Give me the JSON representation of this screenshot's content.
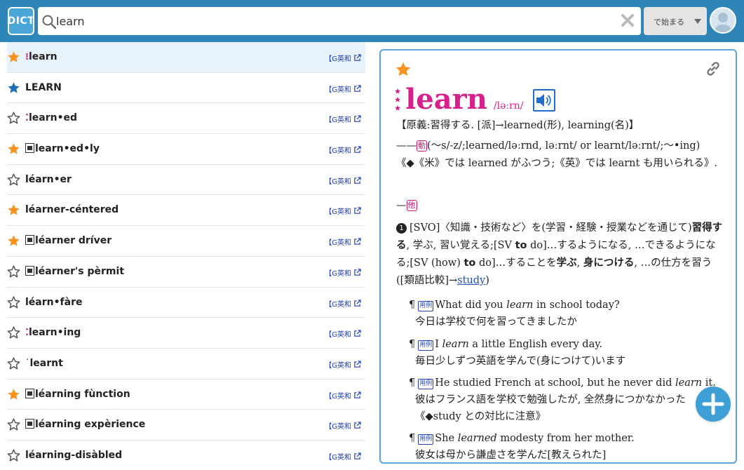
{
  "app": {
    "logo_text": "DICT",
    "colors": {
      "header": "#2e86b8",
      "accent": "#d6208b",
      "star_on_orange": "#f7931e",
      "star_on_blue": "#1f6fb8"
    }
  },
  "search": {
    "value": "learn",
    "mode_label": "で始まる"
  },
  "words": [
    {
      "word": "learn",
      "prefix": "⁝",
      "star": "orange",
      "tag": "【G英和",
      "selected": true
    },
    {
      "word": "LEARN",
      "prefix": "",
      "star": "blue",
      "tag": "【G英和"
    },
    {
      "word": "learn•ed",
      "prefix": "⁚",
      "star": "outline",
      "tag": "【G英和"
    },
    {
      "word": "learn•ed•ly",
      "prefix": "",
      "kanji": true,
      "star": "orange",
      "tag": "【G英和"
    },
    {
      "word": "léarn•er",
      "prefix": "",
      "star": "outline",
      "tag": "【G英和"
    },
    {
      "word": "léarner‐céntered",
      "prefix": "",
      "star": "orange",
      "tag": "【G英和"
    },
    {
      "word": "léarner dríver",
      "prefix": "",
      "kanji": true,
      "star": "orange",
      "tag": "【G英和"
    },
    {
      "word": "léarner's pèrmit",
      "prefix": "",
      "kanji": true,
      "star": "outline",
      "tag": "【G英和"
    },
    {
      "word": "léarn•fàre",
      "prefix": "",
      "star": "outline",
      "tag": "【G英和"
    },
    {
      "word": "learn•ing",
      "prefix": "⁚",
      "star": "outline",
      "tag": "【G英和"
    },
    {
      "word": "learnt",
      "prefix": "˙",
      "star": "outline",
      "tag": "【G英和"
    },
    {
      "word": "léarning fùnction",
      "prefix": "",
      "kanji": true,
      "star": "orange",
      "tag": "【G英和"
    },
    {
      "word": "léarning expèrience",
      "prefix": "",
      "kanji": true,
      "star": "outline",
      "tag": "【G英和"
    },
    {
      "word": "léarning‐disàbled",
      "prefix": "",
      "star": "outline",
      "tag": "【G英和"
    }
  ],
  "entry": {
    "headword": "learn",
    "pronunciation": "/ləːrn/",
    "etymology": "【原義:習得する. [派]→learned(形), learning(名)】",
    "inflection_prefix": "——",
    "pos_verb": "動",
    "inflection": "(〜s/-z/;learned/ləːrnd, ləːrnt/ or learnt/ləːrnt/;〜•ing)",
    "usage_note": "《◆《米》では learned がふつう;《英》では learnt も用いられる》.",
    "trans_prefix": "—",
    "pos_trans": "他",
    "sense_num": "1",
    "sense_a": "[SVO]〈知識・技術など〉を(学習・経験・授業などを通じて)",
    "sense_b1": "習得する",
    "sense_b2": ", 学ぶ, 習い覚える;[SV ",
    "sense_b3": "to",
    "sense_b4": " do]…するようになる, …できるようになる;[SV (how) ",
    "sense_b5": "to",
    "sense_b6": " do]…することを",
    "sense_b7": "学ぶ",
    "sense_b8": ", ",
    "sense_b9": "身につける",
    "sense_b10": ", …の仕方を習う([類語比較]→",
    "sense_link": "study",
    "sense_end": ")",
    "example_badge": "用例",
    "examples": [
      {
        "en_a": "What did you ",
        "en_i": "learn",
        "en_b": " in school today?",
        "ja": "今日は学校で何を習ってきましたか"
      },
      {
        "en_a": "I ",
        "en_i": "learn",
        "en_b": " a little English every day.",
        "ja": "毎日少しずつ英語を学んで(身につけて)います"
      },
      {
        "en_a": "He studied French at school, but he never did ",
        "en_i": "learn",
        "en_b": " it.",
        "ja": "彼はフランス語を学校で勉強したが, 全然身につかなかった",
        "note": "《◆study との対比に注意》"
      },
      {
        "en_a": "She ",
        "en_i": "learned",
        "en_b": " modesty from her mother.",
        "ja": "彼女は母から謙虚さを学んだ[教えられた]"
      }
    ]
  }
}
